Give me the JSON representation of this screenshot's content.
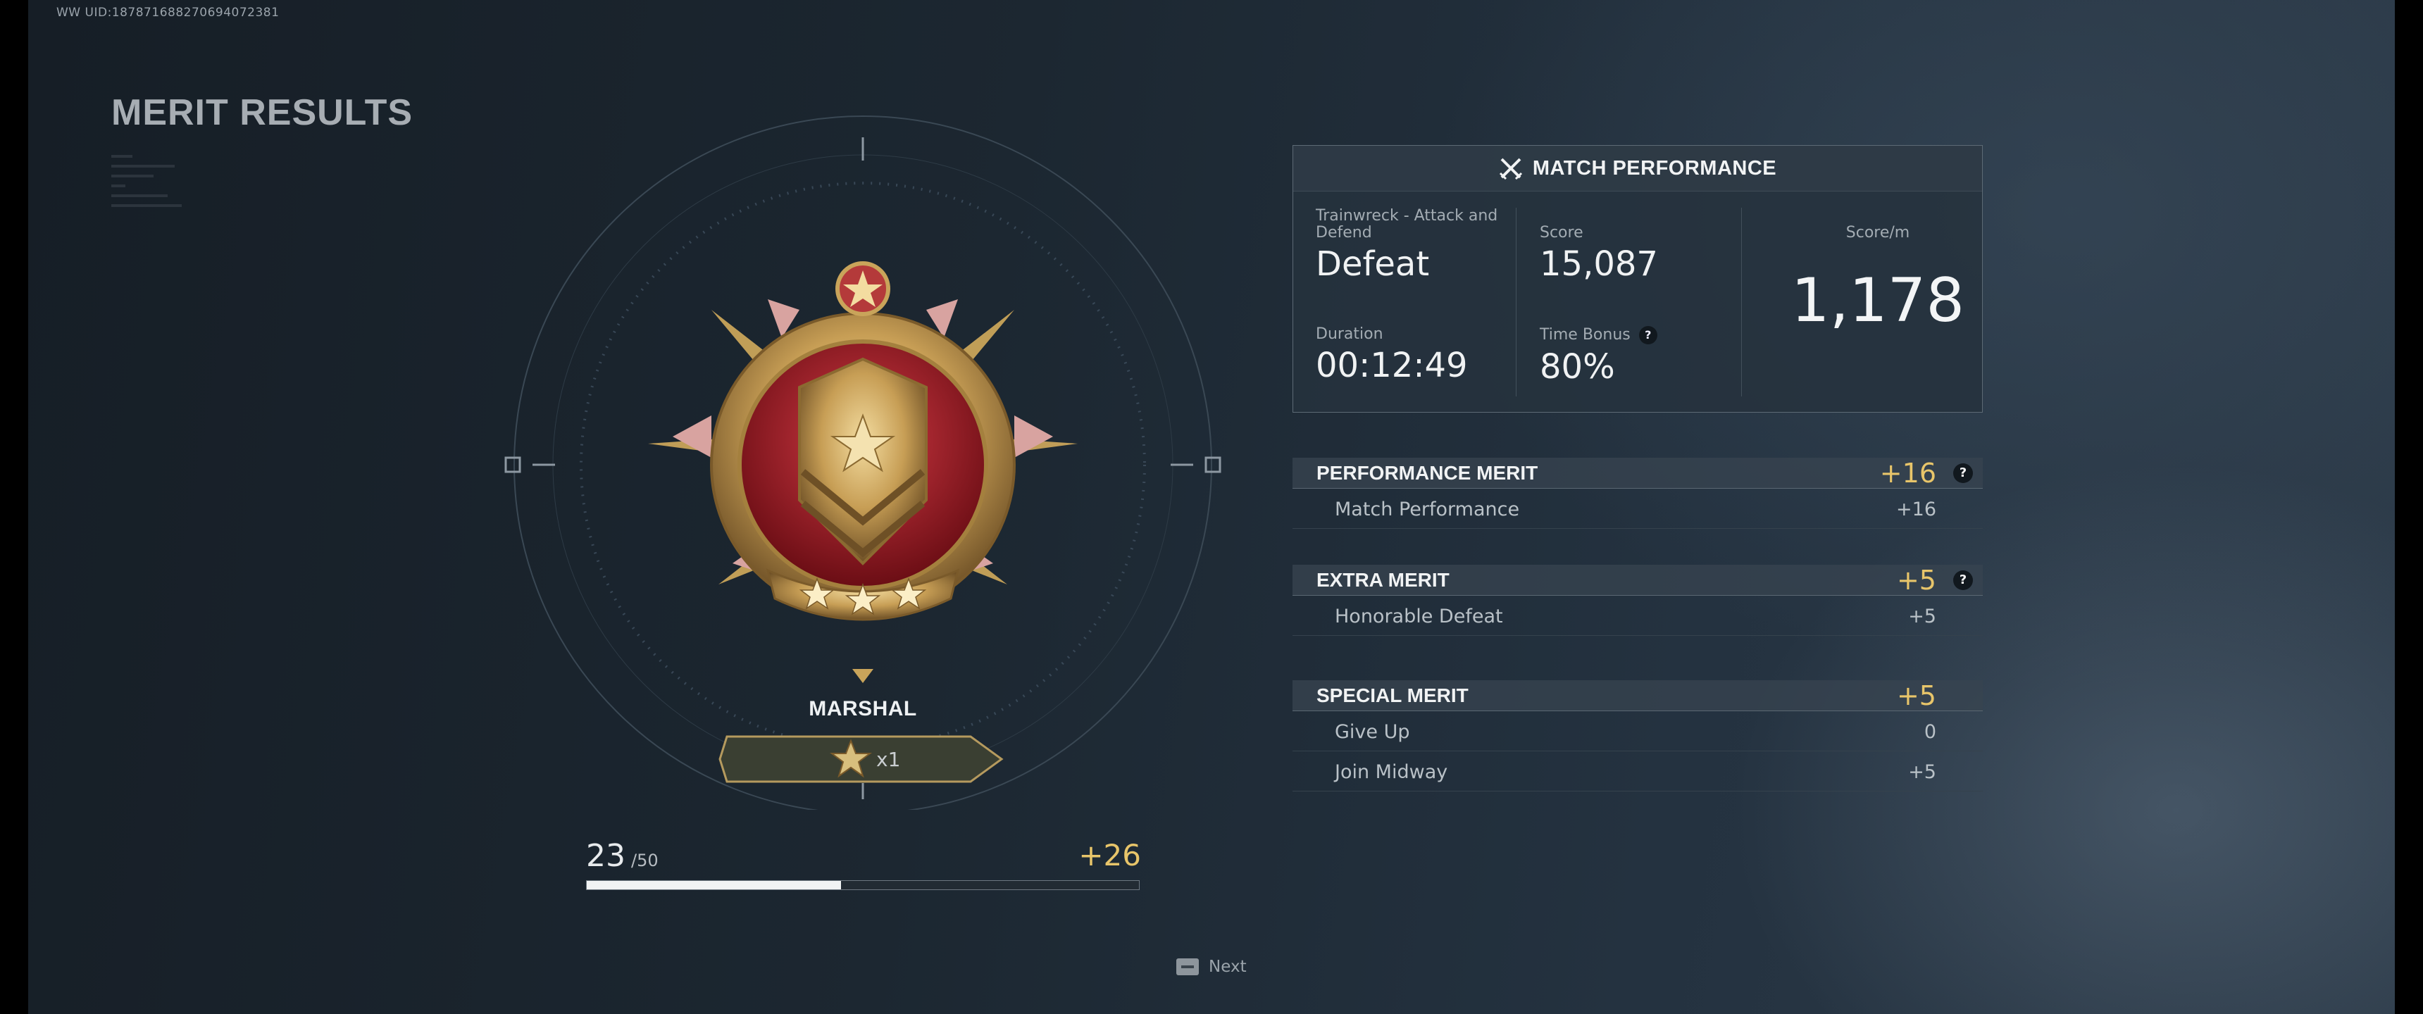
{
  "uid_text": "WW UID:187871688270694072381",
  "title": "MERIT RESULTS",
  "rank": {
    "name": "MARSHAL",
    "multiplier": "x1"
  },
  "progress": {
    "current": "23",
    "max": "/50",
    "gain": "+26",
    "fraction": 0.46
  },
  "match_performance": {
    "title": "MATCH PERFORMANCE",
    "map_mode": "Trainwreck - Attack and Defend",
    "result": "Defeat",
    "score_label": "Score",
    "score": "15,087",
    "score_per_min_label": "Score/m",
    "score_per_min": "1,178",
    "duration_label": "Duration",
    "duration": "00:12:49",
    "time_bonus_label": "Time Bonus",
    "time_bonus": "80%"
  },
  "merit_sections": [
    {
      "title": "PERFORMANCE MERIT",
      "value": "+16",
      "help": "?",
      "items": [
        {
          "label": "Match Performance",
          "value": "+16"
        }
      ]
    },
    {
      "title": "EXTRA MERIT",
      "value": "+5",
      "help": "?",
      "items": [
        {
          "label": "Honorable Defeat",
          "value": "+5"
        }
      ]
    },
    {
      "title": "SPECIAL MERIT",
      "value": "+5",
      "items": [
        {
          "label": "Give Up",
          "value": "0"
        },
        {
          "label": "Join Midway",
          "value": "+5"
        }
      ]
    }
  ],
  "help_glyph": "?",
  "next_label": "Next",
  "colors": {
    "accent_gold": "#e8c56a",
    "panel": "#26323d",
    "emblem_red": "#b0202a",
    "emblem_gold": "#c9a45a"
  }
}
